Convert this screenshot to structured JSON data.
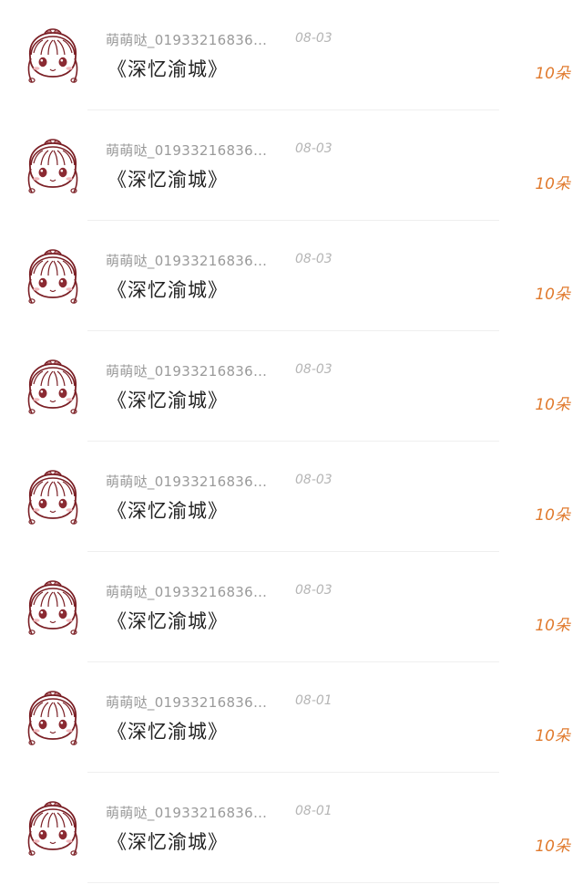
{
  "colors": {
    "accent": "#e07a2e",
    "sender_text": "#9a9a9a",
    "date_text": "#b5b5b5",
    "title_text": "#222222",
    "avatar_line": "#7a1e24"
  },
  "avatar_icon": "chibi-girl-avatar",
  "messages": [
    {
      "sender": "萌萌哒_019332168362 …",
      "date": "08-03",
      "title": "《深忆渝城》",
      "gift_count": "10朵"
    },
    {
      "sender": "萌萌哒_019332168362 …",
      "date": "08-03",
      "title": "《深忆渝城》",
      "gift_count": "10朵"
    },
    {
      "sender": "萌萌哒_019332168362 …",
      "date": "08-03",
      "title": "《深忆渝城》",
      "gift_count": "10朵"
    },
    {
      "sender": "萌萌哒_019332168362 …",
      "date": "08-03",
      "title": "《深忆渝城》",
      "gift_count": "10朵"
    },
    {
      "sender": "萌萌哒_019332168362 …",
      "date": "08-03",
      "title": "《深忆渝城》",
      "gift_count": "10朵"
    },
    {
      "sender": "萌萌哒_019332168362 …",
      "date": "08-03",
      "title": "《深忆渝城》",
      "gift_count": "10朵"
    },
    {
      "sender": "萌萌哒_019332168362 …",
      "date": "08-01",
      "title": "《深忆渝城》",
      "gift_count": "10朵"
    },
    {
      "sender": "萌萌哒_019332168362 …",
      "date": "08-01",
      "title": "《深忆渝城》",
      "gift_count": "10朵"
    }
  ]
}
